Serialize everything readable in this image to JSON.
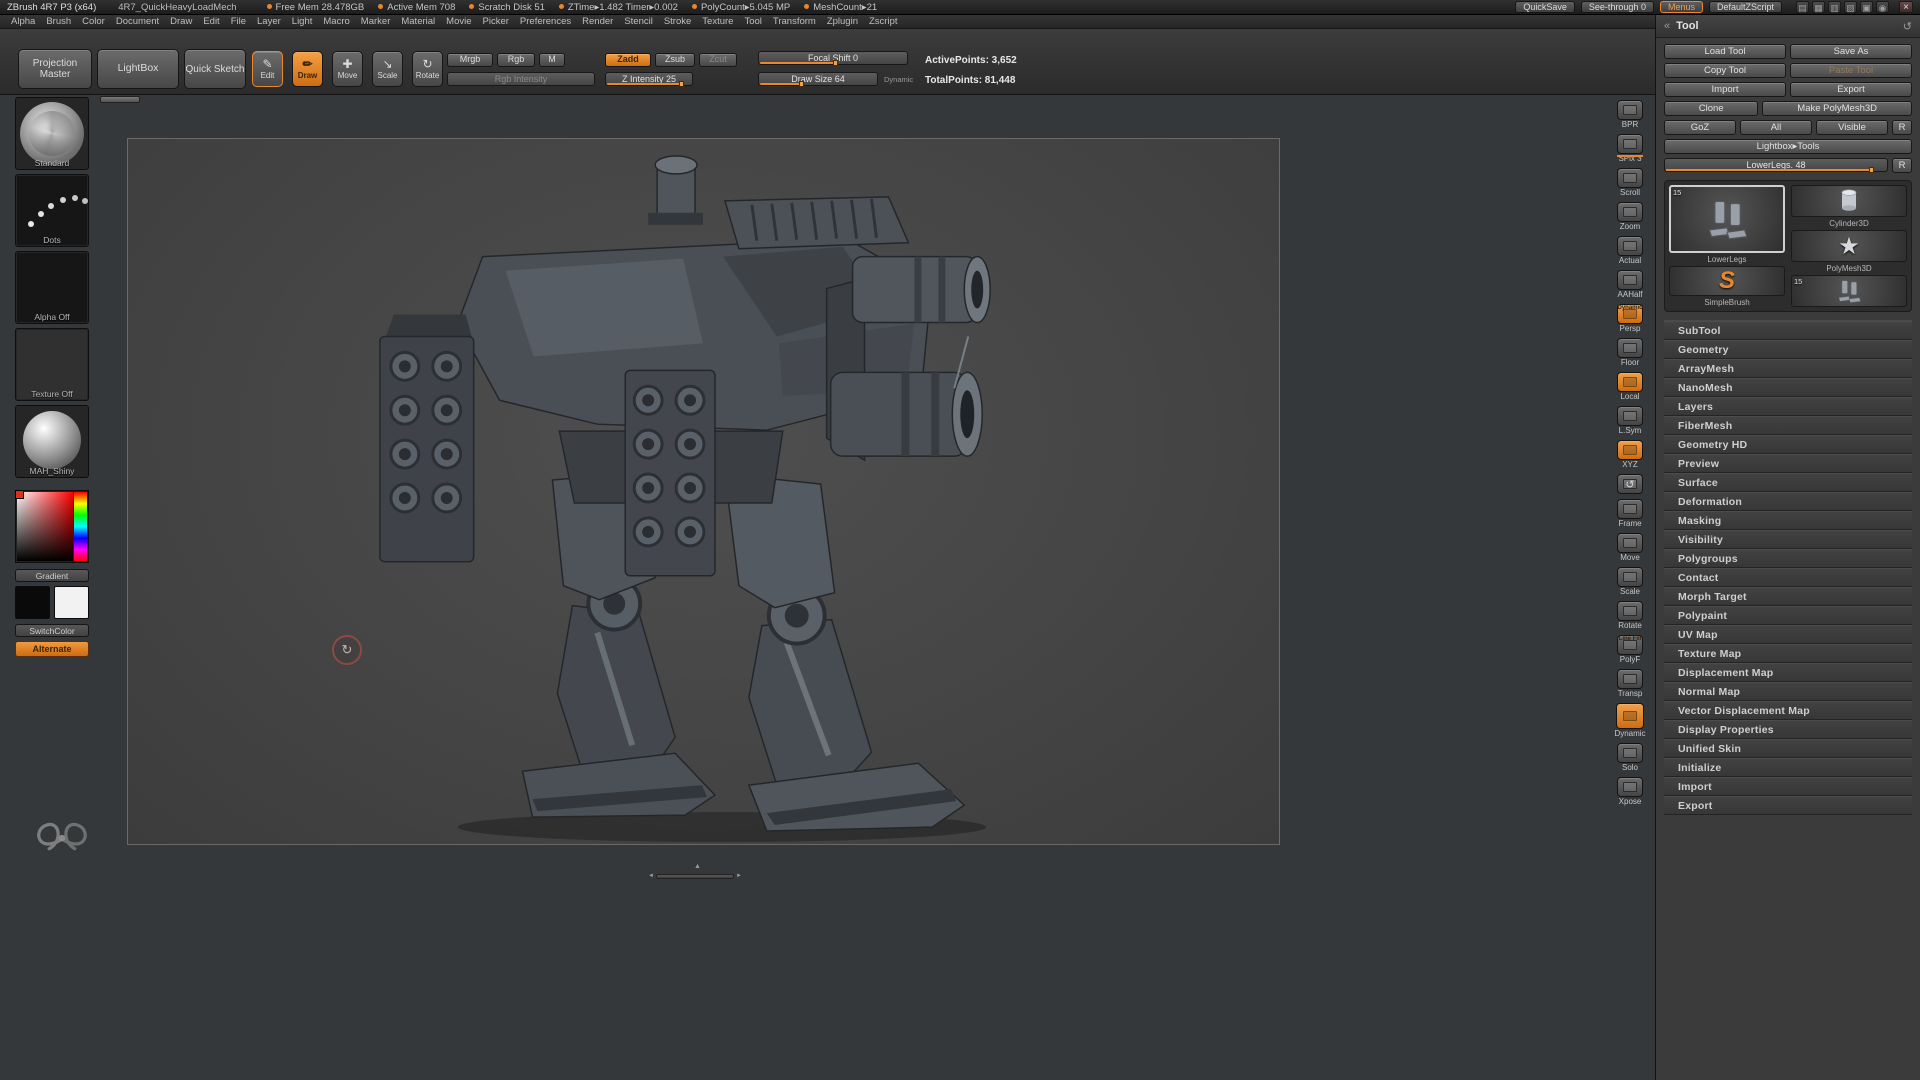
{
  "colors": {
    "accent_orange": "#e8872b",
    "ui_background": "#2e2e2e",
    "canvas_grey": "#474747"
  },
  "titlebar": {
    "app": "ZBrush 4R7 P3 (x64)",
    "doc": "4R7_QuickHeavyLoadMech",
    "stats": [
      "Free Mem 28.478GB",
      "Active Mem 708",
      "Scratch Disk 51",
      "ZTime▸1.482  Timer▸0.002",
      "PolyCount▸5.045 MP",
      "MeshCount▸21"
    ],
    "quicksave": "QuickSave",
    "seethrough": "See-through 0",
    "menus": "Menus",
    "zscript": "DefaultZScript",
    "window_icons": [
      "▤",
      "▦",
      "▥",
      "▧",
      "▣",
      "◉"
    ],
    "close": "×"
  },
  "menubar": {
    "items": [
      "Alpha",
      "Brush",
      "Color",
      "Document",
      "Draw",
      "Edit",
      "File",
      "Layer",
      "Light",
      "Macro",
      "Marker",
      "Material",
      "Movie",
      "Picker",
      "Preferences",
      "Render",
      "Stencil",
      "Stroke",
      "Texture",
      "Tool",
      "Transform",
      "Zplugin",
      "Zscript"
    ]
  },
  "shelf": {
    "projection_master": "Projection Master",
    "lightbox": "LightBox",
    "quick_sketch": "Quick Sketch",
    "tool_modes": [
      {
        "glyph": "✎",
        "label": "Edit",
        "cls": "outline"
      },
      {
        "glyph": "✏",
        "label": "Draw",
        "cls": "orange"
      },
      {
        "glyph": "✚",
        "label": "Move"
      },
      {
        "glyph": "↘",
        "label": "Scale"
      },
      {
        "glyph": "↻",
        "label": "Rotate"
      }
    ],
    "mrgb": "Mrgb",
    "rgb": "Rgb",
    "m": "M",
    "zadd": "Zadd",
    "zsub": "Zsub",
    "zcut": "Zcut",
    "rgb_intensity": "Rgb Intensity",
    "z_intensity": "Z Intensity 25",
    "focal_shift": "Focal Shift 0",
    "draw_size": "Draw Size 64",
    "dynamic": "Dynamic",
    "active_points": "ActivePoints: 3,652",
    "total_points": "TotalPoints: 81,448"
  },
  "left_tray": {
    "brush": "Standard",
    "stroke": "Dots",
    "alpha": "Alpha Off",
    "texture": "Texture Off",
    "material": "MAH_Shiny",
    "gradient": "Gradient",
    "switchcolor": "SwitchColor",
    "alternate": "Alternate"
  },
  "canvas": {
    "cursor_glyph": "↻",
    "scroll_left": "◄",
    "scroll_right": "►",
    "tray_toggle": "▲"
  },
  "right_shelf": {
    "buttons": [
      {
        "label": "BPR"
      },
      {
        "label": "SPix 3",
        "cls": "has-slider"
      },
      {
        "label": "Scroll"
      },
      {
        "label": "Zoom"
      },
      {
        "label": "Actual"
      },
      {
        "label": "AAHalf"
      },
      {
        "top": "Dynamic",
        "label": "Persp",
        "cls": "active"
      },
      {
        "label": "Floor"
      },
      {
        "label": "Local",
        "cls": "active"
      },
      {
        "label": "L.Sym"
      },
      {
        "label": "XYZ",
        "cls": "active"
      },
      {
        "label": "",
        "glyph": "↺"
      },
      {
        "label": "Frame"
      },
      {
        "label": "Move"
      },
      {
        "label": "Scale"
      },
      {
        "label": "Rotate"
      },
      {
        "top": "Line Fill",
        "label": "PolyF"
      },
      {
        "label": "Transp"
      },
      {
        "label": "Dynamic",
        "cls": "active big"
      },
      {
        "label": "Solo"
      },
      {
        "label": "Xpose"
      }
    ]
  },
  "tool_panel": {
    "title": "Tool",
    "icons": {
      "collapse": "«",
      "history": "↺"
    },
    "buttons": {
      "load_tool": "Load Tool",
      "save_as": "Save As",
      "copy_tool": "Copy Tool",
      "paste_tool": "Paste Tool",
      "import": "Import",
      "export": "Export",
      "clone": "Clone",
      "make_polymesh": "Make PolyMesh3D",
      "goz": "GoZ",
      "all": "All",
      "visible": "Visible",
      "r": "R"
    },
    "lightbox_tools": "Lightbox▸Tools",
    "active_tool_slider": "LowerLegs. 48",
    "r_button": "R",
    "thumbs": {
      "selected": {
        "label": "LowerLegs",
        "badge": "15"
      },
      "cylinder": {
        "label": "Cylinder3D"
      },
      "polymesh": {
        "label": "PolyMesh3D",
        "glyph": "★"
      },
      "simplebrush": {
        "label": "SimpleBrush",
        "glyph": "S"
      },
      "lowerlegs": {
        "label": "LowerLegs",
        "badge": "15"
      }
    },
    "sections": [
      "SubTool",
      "Geometry",
      "ArrayMesh",
      "NanoMesh",
      "Layers",
      "FiberMesh",
      "Geometry HD",
      "Preview",
      "Surface",
      "Deformation",
      "Masking",
      "Visibility",
      "Polygroups",
      "Contact",
      "Morph Target",
      "Polypaint",
      "UV Map",
      "Texture Map",
      "Displacement Map",
      "Normal Map",
      "Vector Displacement Map",
      "Display Properties",
      "Unified Skin",
      "Initialize",
      "Import",
      "Export"
    ]
  }
}
